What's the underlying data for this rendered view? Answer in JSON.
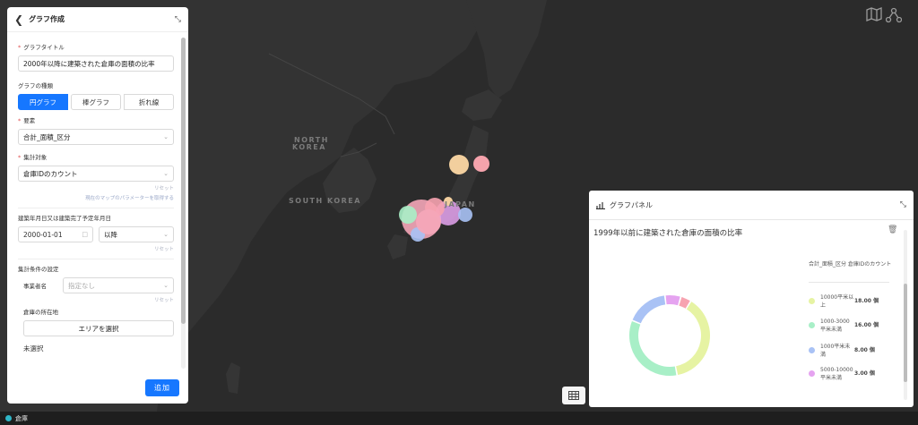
{
  "map": {
    "labels": {
      "north_korea_1": "NORTH",
      "north_korea_2": "KOREA",
      "south_korea": "SOUTH KOREA",
      "japan": "JAPAN"
    },
    "tools": {
      "map_icon": "map-icon",
      "share_icon": "share-icon"
    }
  },
  "statusbar": {
    "layer_name": "倉庫"
  },
  "left_panel": {
    "title": "グラフ作成",
    "graph_title_label": "グラフタイトル",
    "graph_title_value": "2000年以降に建築された倉庫の面積の比率",
    "graph_type_label": "グラフの種類",
    "graph_types": [
      "円グラフ",
      "棒グラフ",
      "折れ線"
    ],
    "element_label": "要素",
    "element_value": "合計_面積_区分",
    "aggregate_label": "集計対象",
    "aggregate_value": "倉庫IDのカウント",
    "reset_label": "リセット",
    "use_map_params_link": "現在のマップのパラメーターを取得する",
    "date_section_label": "建築年月日又は建築完了予定年月日",
    "date_value": "2000-01-01",
    "date_op_value": "以降",
    "condition_section_label": "集計条件の設定",
    "operator_label": "事業者名",
    "operator_placeholder": "指定なし",
    "location_label": "倉庫の所在地",
    "select_area_button": "エリアを選択",
    "unselected_text": "未選択",
    "add_button": "追加"
  },
  "graph_panel": {
    "header_title": "グラフパネル",
    "chart_title": "1999年以前に建築された倉庫の面積の比率",
    "legend_header": "合計_面積_区分 倉庫IDのカウント",
    "colors": [
      "#e6f3a3",
      "#a8efc7",
      "#a9c2f5",
      "#e5a3f0",
      "#f7a3b0"
    ]
  },
  "chart_data": {
    "type": "pie",
    "title": "1999年以前に建築された倉庫の面積の比率",
    "categories": [
      "10000平米以上",
      "1000-3000平米未満",
      "1000平米未満",
      "5000-10000平米未満",
      ""
    ],
    "values": [
      18,
      16,
      8,
      3,
      2
    ],
    "value_labels": [
      "18.00 個",
      "16.00 個",
      "8.00 個",
      "3.00 個"
    ],
    "legend": "right"
  }
}
